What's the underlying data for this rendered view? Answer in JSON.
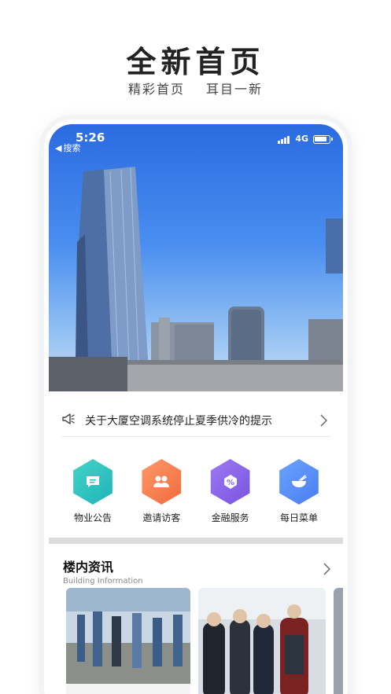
{
  "promo": {
    "title": "全新首页",
    "subtitle_left": "精彩首页",
    "subtitle_right": "耳目一新"
  },
  "statusbar": {
    "time": "5:26",
    "back_label": "搜索",
    "network": "4G"
  },
  "notice": {
    "text": "关于大厦空调系统停止夏季供冷的提示"
  },
  "services": [
    {
      "label": "物业公告",
      "icon": "announcement-icon",
      "color_from": "#45d4c8",
      "color_to": "#1fb3b8"
    },
    {
      "label": "邀请访客",
      "icon": "visitors-icon",
      "color_from": "#ff9a6a",
      "color_to": "#f06a3c"
    },
    {
      "label": "金融服务",
      "icon": "finance-icon",
      "color_from": "#9c7bf2",
      "color_to": "#7a52e0"
    },
    {
      "label": "每日菜单",
      "icon": "bowl-icon",
      "color_from": "#6ba4ff",
      "color_to": "#4a7cf0"
    }
  ],
  "news": {
    "title": "楼内资讯",
    "subtitle": "Building Information"
  },
  "colors": {
    "sky": "#3b7ee8",
    "divider": "#dcdcdc"
  }
}
